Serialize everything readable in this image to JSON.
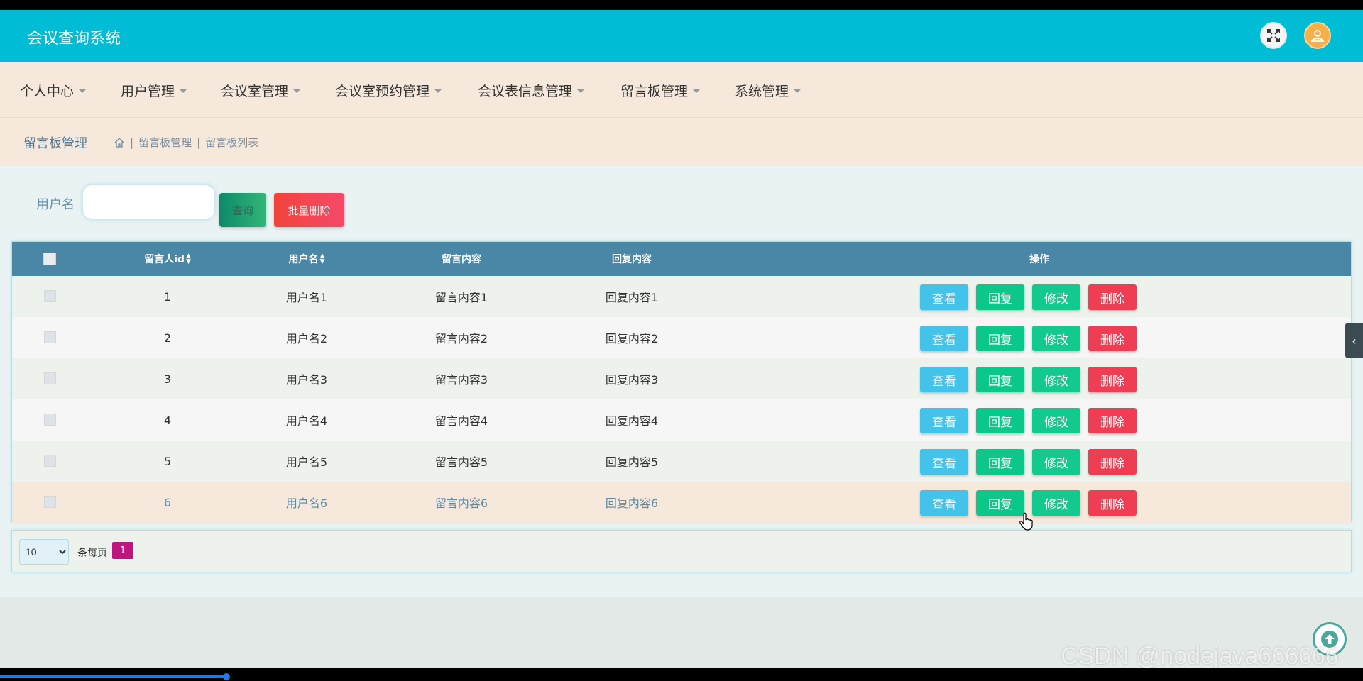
{
  "app": {
    "title": "会议查询系统"
  },
  "nav": {
    "items": [
      {
        "label": "个人中心"
      },
      {
        "label": "用户管理"
      },
      {
        "label": "会议室管理"
      },
      {
        "label": "会议室预约管理"
      },
      {
        "label": "会议表信息管理"
      },
      {
        "label": "留言板管理"
      },
      {
        "label": "系统管理"
      }
    ]
  },
  "breadcrumb": {
    "title": "留言板管理",
    "path": [
      "留言板管理",
      "留言板列表"
    ]
  },
  "search": {
    "label": "用户名",
    "value": "",
    "placeholder": "",
    "search_button": "查询",
    "batch_delete_button": "批量删除"
  },
  "table": {
    "headers": {
      "id": "留言人id",
      "username": "用户名",
      "content": "留言内容",
      "reply": "回复内容",
      "actions": "操作"
    },
    "action_labels": {
      "view": "查看",
      "reply": "回复",
      "edit": "修改",
      "delete": "删除"
    },
    "rows": [
      {
        "id": "1",
        "username": "用户名1",
        "content": "留言内容1",
        "reply": "回复内容1"
      },
      {
        "id": "2",
        "username": "用户名2",
        "content": "留言内容2",
        "reply": "回复内容2"
      },
      {
        "id": "3",
        "username": "用户名3",
        "content": "留言内容3",
        "reply": "回复内容3"
      },
      {
        "id": "4",
        "username": "用户名4",
        "content": "留言内容4",
        "reply": "回复内容4"
      },
      {
        "id": "5",
        "username": "用户名5",
        "content": "留言内容5",
        "reply": "回复内容5"
      },
      {
        "id": "6",
        "username": "用户名6",
        "content": "留言内容6",
        "reply": "回复内容6"
      }
    ],
    "highlighted_row": 6
  },
  "pagination": {
    "page_size": "10",
    "page_size_label": "条每页",
    "current_page": "1"
  },
  "watermark": "CSDN @nodejava666666",
  "colors": {
    "header": "#00bcd4",
    "nav_bg": "#f6e8da",
    "table_head": "#4a87a6",
    "view": "#44c3ea",
    "reply": "#0cc78a",
    "edit": "#14c98e",
    "delete": "#ef3e53",
    "page_active": "#c0157f"
  }
}
